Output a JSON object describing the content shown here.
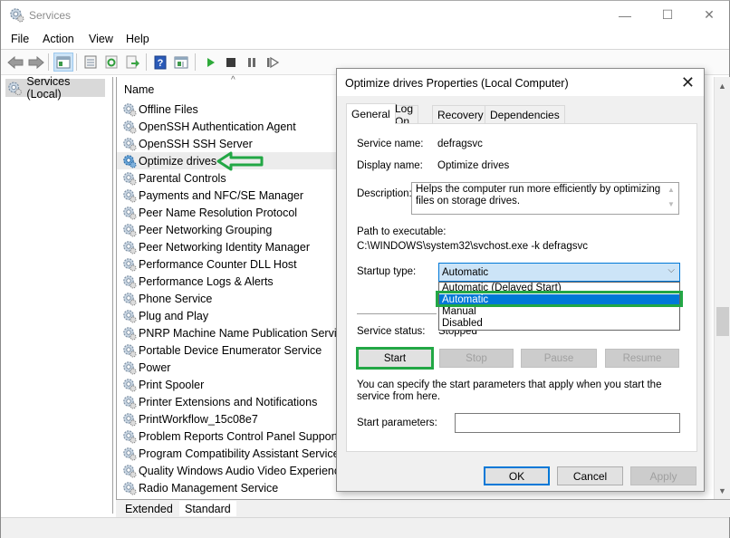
{
  "window": {
    "title": "Services",
    "controls": {
      "minimize": "—",
      "maximize": "☐",
      "close": "✕"
    }
  },
  "menu": [
    "File",
    "Action",
    "View",
    "Help"
  ],
  "toolbar": {
    "buttons": [
      "back",
      "forward",
      "show-hide-console-tree",
      "properties",
      "refresh",
      "export-list",
      "help",
      "show-hide-action-pane",
      "start-service",
      "stop-service",
      "pause-service",
      "restart-service"
    ]
  },
  "tree": {
    "root": "Services (Local)"
  },
  "list": {
    "column_name": "Name",
    "sort_indicator": "^",
    "selected_index": 3,
    "items": [
      "Offline Files",
      "OpenSSH Authentication Agent",
      "OpenSSH SSH Server",
      "Optimize drives",
      "Parental Controls",
      "Payments and NFC/SE Manager",
      "Peer Name Resolution Protocol",
      "Peer Networking Grouping",
      "Peer Networking Identity Manager",
      "Performance Counter DLL Host",
      "Performance Logs & Alerts",
      "Phone Service",
      "Plug and Play",
      "PNRP Machine Name Publication Service",
      "Portable Device Enumerator Service",
      "Power",
      "Print Spooler",
      "Printer Extensions and Notifications",
      "PrintWorkflow_15c08e7",
      "Problem Reports Control Panel Support",
      "Program Compatibility Assistant Service",
      "Quality Windows Audio Video Experience",
      "Radio Management Service"
    ]
  },
  "view_tabs": [
    "Extended",
    "Standard"
  ],
  "dialog": {
    "title": "Optimize drives Properties (Local Computer)",
    "close": "✕",
    "tabs": [
      "General",
      "Log On",
      "Recovery",
      "Dependencies"
    ],
    "active_tab": "General",
    "service_name_label": "Service name:",
    "service_name": "defragsvc",
    "display_name_label": "Display name:",
    "display_name": "Optimize drives",
    "description_label": "Description:",
    "description": "Helps the computer run more efficiently by optimizing files on storage drives.",
    "path_label": "Path to executable:",
    "path": "C:\\WINDOWS\\system32\\svchost.exe -k defragsvc",
    "startup_type_label": "Startup type:",
    "startup_type_value": "Automatic",
    "startup_options": [
      "Automatic (Delayed Start)",
      "Automatic",
      "Manual",
      "Disabled"
    ],
    "startup_highlighted": "Automatic",
    "service_status_label": "Service status:",
    "service_status": "Stopped",
    "buttons": {
      "start": "Start",
      "stop": "Stop",
      "pause": "Pause",
      "resume": "Resume"
    },
    "hint": "You can specify the start parameters that apply when you start the service from here.",
    "start_params_label": "Start parameters:",
    "start_params_value": "",
    "footer": {
      "ok": "OK",
      "cancel": "Cancel",
      "apply": "Apply"
    }
  },
  "annotation_color": "#22a745",
  "accent_color": "#0078d7"
}
